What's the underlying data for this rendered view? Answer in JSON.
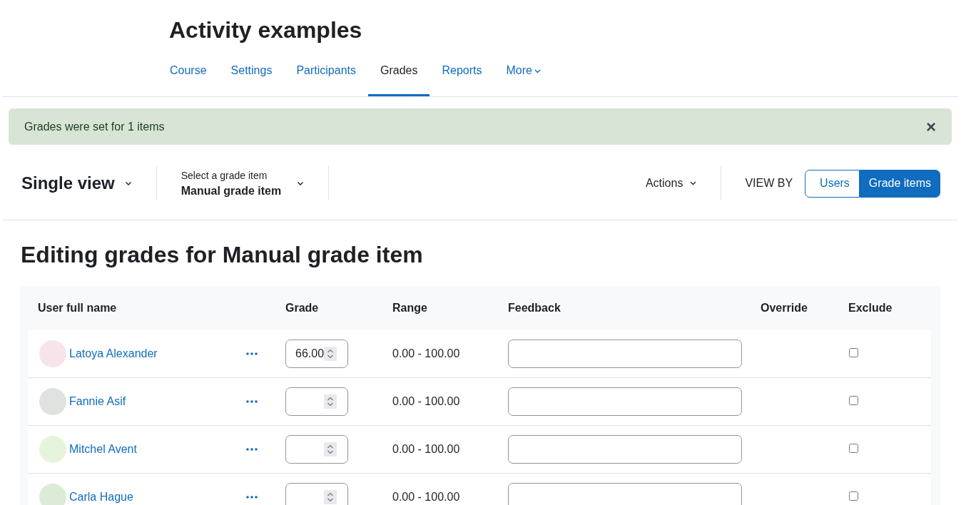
{
  "course_title": "Activity examples",
  "tabs": [
    {
      "label": "Course",
      "selected": false
    },
    {
      "label": "Settings",
      "selected": false
    },
    {
      "label": "Participants",
      "selected": false
    },
    {
      "label": "Grades",
      "selected": true
    },
    {
      "label": "Reports",
      "selected": false
    },
    {
      "label": "More",
      "selected": false
    }
  ],
  "alert": {
    "message": "Grades were set for 1 items",
    "close": "×"
  },
  "toolbar": {
    "view_selector": "Single view",
    "item_label": "Select a grade item",
    "item_value": "Manual grade item",
    "actions": "Actions",
    "view_by_label": "VIEW BY",
    "view_by": [
      {
        "label": "Users",
        "selected": false
      },
      {
        "label": "Grade items",
        "selected": true
      }
    ]
  },
  "heading": "Editing grades for Manual grade item",
  "table": {
    "columns": [
      "User full name",
      "Grade",
      "Range",
      "Feedback",
      "Override",
      "Exclude"
    ],
    "rows": [
      {
        "name": "Latoya Alexander",
        "grade": "66.00",
        "range": "0.00 - 100.00",
        "feedback": "",
        "exclude": false
      },
      {
        "name": "Fannie Asif",
        "grade": "",
        "range": "0.00 - 100.00",
        "feedback": "",
        "exclude": false
      },
      {
        "name": "Mitchel Avent",
        "grade": "",
        "range": "0.00 - 100.00",
        "feedback": "",
        "exclude": false
      },
      {
        "name": "Carla Hague",
        "grade": "",
        "range": "0.00 - 100.00",
        "feedback": "",
        "exclude": false
      }
    ]
  }
}
